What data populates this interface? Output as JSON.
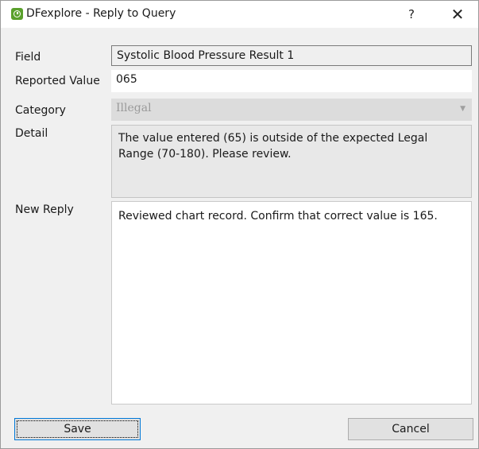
{
  "window": {
    "title": "DFexplore - Reply to Query",
    "help_glyph": "?",
    "close_glyph": "✕"
  },
  "form": {
    "field_label": "Field",
    "field_value": "Systolic Blood Pressure Result 1",
    "reported_label": "Reported Value",
    "reported_value": "065",
    "category_label": "Category",
    "category_value": "Illegal",
    "detail_label": "Detail",
    "detail_text": "The value entered (65) is outside of the expected Legal Range (70-180). Please review.",
    "reply_label": "New Reply",
    "reply_text": "Reviewed chart record. Confirm that correct value is 165."
  },
  "buttons": {
    "save": "Save",
    "cancel": "Cancel"
  },
  "colors": {
    "app_icon": "#5aa02c",
    "focus_border": "#0078d7"
  }
}
